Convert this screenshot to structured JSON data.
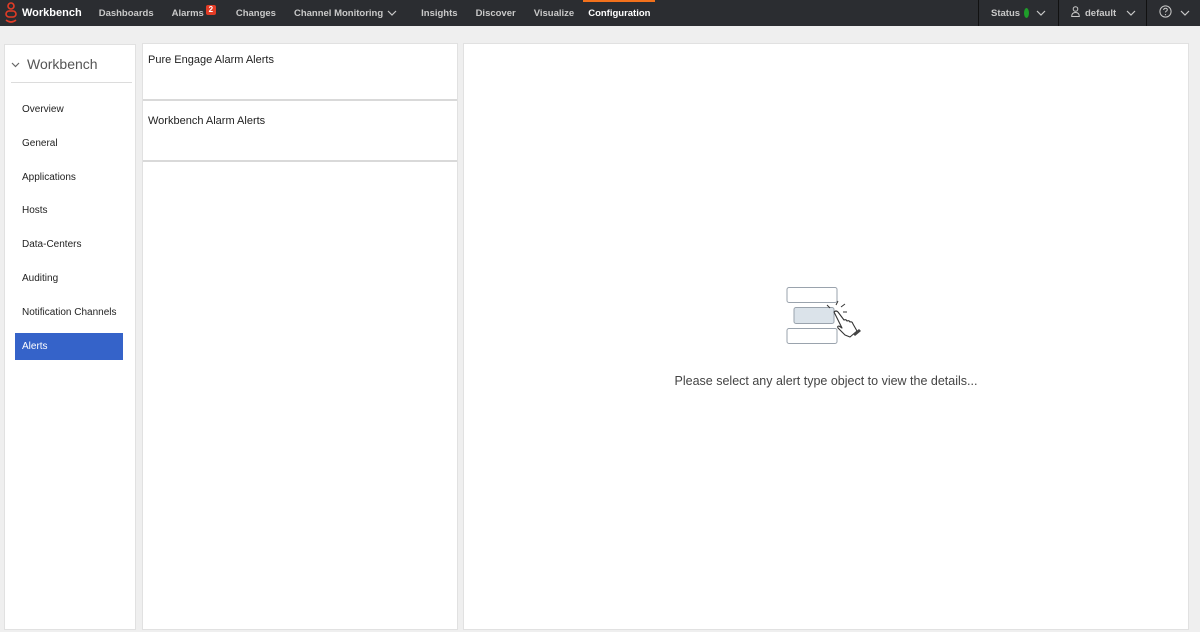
{
  "app": {
    "name": "Workbench",
    "brand_color": "#e33c26"
  },
  "nav": {
    "items": [
      {
        "label": "Dashboards",
        "active": false
      },
      {
        "label": "Alarms",
        "badge": "2",
        "active": false
      },
      {
        "label": "Changes",
        "active": false
      },
      {
        "label": "Channel Monitoring",
        "dropdown": true,
        "active": false
      },
      {
        "label": "Insights",
        "active": false
      },
      {
        "label": "Discover",
        "active": false
      },
      {
        "label": "Visualize",
        "active": false
      },
      {
        "label": "Configuration",
        "active": true
      }
    ],
    "active_indicator_color": "#f2711c"
  },
  "topbar_right": {
    "status_label": "Status",
    "status_color": "#1f9d2a",
    "user_label": "default",
    "help_icon": "help-circle-icon"
  },
  "sidebar": {
    "title": "Workbench",
    "items": [
      {
        "label": "Overview"
      },
      {
        "label": "General"
      },
      {
        "label": "Applications"
      },
      {
        "label": "Hosts"
      },
      {
        "label": "Data-Centers"
      },
      {
        "label": "Auditing"
      },
      {
        "label": "Notification Channels"
      },
      {
        "label": "Alerts",
        "active": true
      }
    ],
    "active_color": "#3563c9"
  },
  "alert_types": [
    {
      "label": "Pure Engage Alarm Alerts"
    },
    {
      "label": "Workbench Alarm Alerts"
    }
  ],
  "detail": {
    "empty_message": "Please select any alert type object to view the details...",
    "illustration_icon": "select-pointer-icon"
  }
}
